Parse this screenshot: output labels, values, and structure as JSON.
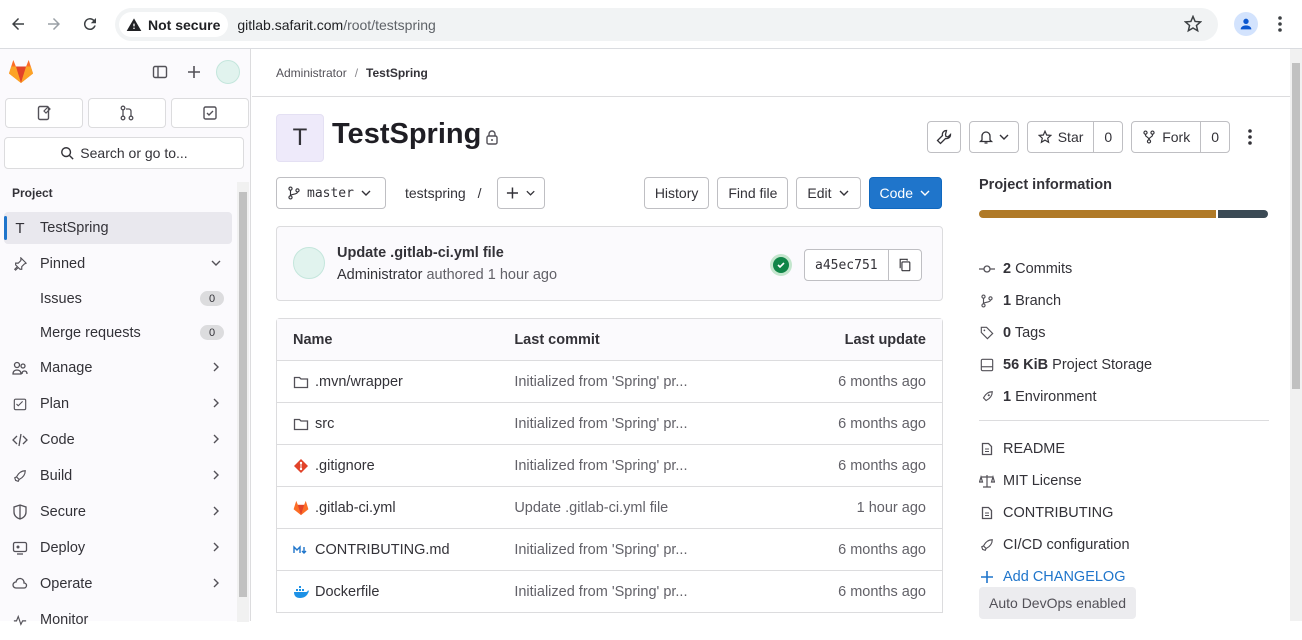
{
  "browser": {
    "security_label": "Not secure",
    "url_host": "gitlab.safarit.com",
    "url_path": "/root/testspring"
  },
  "sidebar": {
    "search_label": "Search or go to...",
    "section_label": "Project",
    "items": [
      {
        "label": "TestSpring",
        "icon": "T",
        "active": true
      },
      {
        "label": "Pinned"
      },
      {
        "label": "Issues",
        "count": "0"
      },
      {
        "label": "Merge requests",
        "count": "0"
      },
      {
        "label": "Manage"
      },
      {
        "label": "Plan"
      },
      {
        "label": "Code"
      },
      {
        "label": "Build"
      },
      {
        "label": "Secure"
      },
      {
        "label": "Deploy"
      },
      {
        "label": "Operate"
      },
      {
        "label": "Monitor"
      }
    ]
  },
  "breadcrumb": {
    "parent": "Administrator",
    "separator": "/",
    "current": "TestSpring"
  },
  "project": {
    "avatar_letter": "T",
    "title": "TestSpring",
    "star_label": "Star",
    "star_count": "0",
    "fork_label": "Fork",
    "fork_count": "0"
  },
  "repo": {
    "branch": "master",
    "path": "testspring",
    "path_sep": "/",
    "history_label": "History",
    "find_file_label": "Find file",
    "edit_label": "Edit",
    "code_label": "Code"
  },
  "commit": {
    "title": "Update .gitlab-ci.yml file",
    "author": "Administrator",
    "meta": "authored 1 hour ago",
    "sha": "a45ec751"
  },
  "files": {
    "headers": {
      "name": "Name",
      "commit": "Last commit",
      "update": "Last update"
    },
    "rows": [
      {
        "icon": "folder-icon",
        "name": ".mvn/wrapper",
        "commit": "Initialized from 'Spring' pr...",
        "update": "6 months ago"
      },
      {
        "icon": "folder-icon",
        "name": "src",
        "commit": "Initialized from 'Spring' pr...",
        "update": "6 months ago"
      },
      {
        "icon": "git-icon",
        "name": ".gitignore",
        "commit": "Initialized from 'Spring' pr...",
        "update": "6 months ago"
      },
      {
        "icon": "gitlab-icon",
        "name": ".gitlab-ci.yml",
        "commit": "Update .gitlab-ci.yml file",
        "update": "1 hour ago"
      },
      {
        "icon": "markdown-icon",
        "name": "CONTRIBUTING.md",
        "commit": "Initialized from 'Spring' pr...",
        "update": "6 months ago"
      },
      {
        "icon": "docker-icon",
        "name": "Dockerfile",
        "commit": "Initialized from 'Spring' pr...",
        "update": "6 months ago"
      }
    ]
  },
  "info": {
    "title": "Project information",
    "language_colors": [
      "#b07a27",
      "#3b4a55"
    ],
    "stats": [
      {
        "icon": "commit-icon",
        "bold": "2",
        "label": "Commits"
      },
      {
        "icon": "branch-icon",
        "bold": "1",
        "label": "Branch"
      },
      {
        "icon": "tag-icon",
        "bold": "0",
        "label": "Tags"
      },
      {
        "icon": "storage-icon",
        "bold": "56 KiB",
        "label": "Project Storage"
      },
      {
        "icon": "environment-icon",
        "bold": "1",
        "label": "Environment"
      }
    ],
    "links": [
      {
        "icon": "file-icon",
        "label": "README"
      },
      {
        "icon": "scale-icon",
        "label": "MIT License"
      },
      {
        "icon": "file-icon",
        "label": "CONTRIBUTING"
      },
      {
        "icon": "rocket-icon",
        "label": "CI/CD configuration"
      },
      {
        "icon": "plus-icon",
        "label": "Add CHANGELOG"
      }
    ],
    "autodevops": "Auto DevOps enabled"
  }
}
